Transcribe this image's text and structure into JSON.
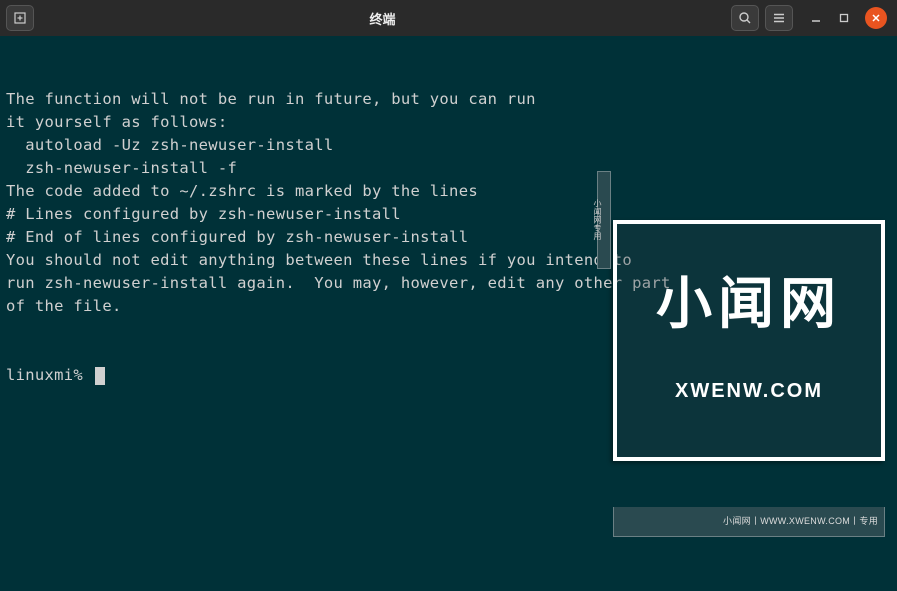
{
  "titlebar": {
    "title": "终端"
  },
  "terminal": {
    "lines": [
      "The function will not be run in future, but you can run",
      "it yourself as follows:",
      "  autoload -Uz zsh-newuser-install",
      "  zsh-newuser-install -f",
      "",
      "The code added to ~/.zshrc is marked by the lines",
      "# Lines configured by zsh-newuser-install",
      "# End of lines configured by zsh-newuser-install",
      "You should not edit anything between these lines if you intend to",
      "run zsh-newuser-install again.  You may, however, edit any other part",
      "of the file."
    ],
    "prompt": "linuxmi% "
  },
  "watermark": {
    "cn": "小闻网",
    "en": "XWENW.COM",
    "bar": "小闻网丨WWW.XWENW.COM丨专用",
    "side": "小闻网专用"
  }
}
